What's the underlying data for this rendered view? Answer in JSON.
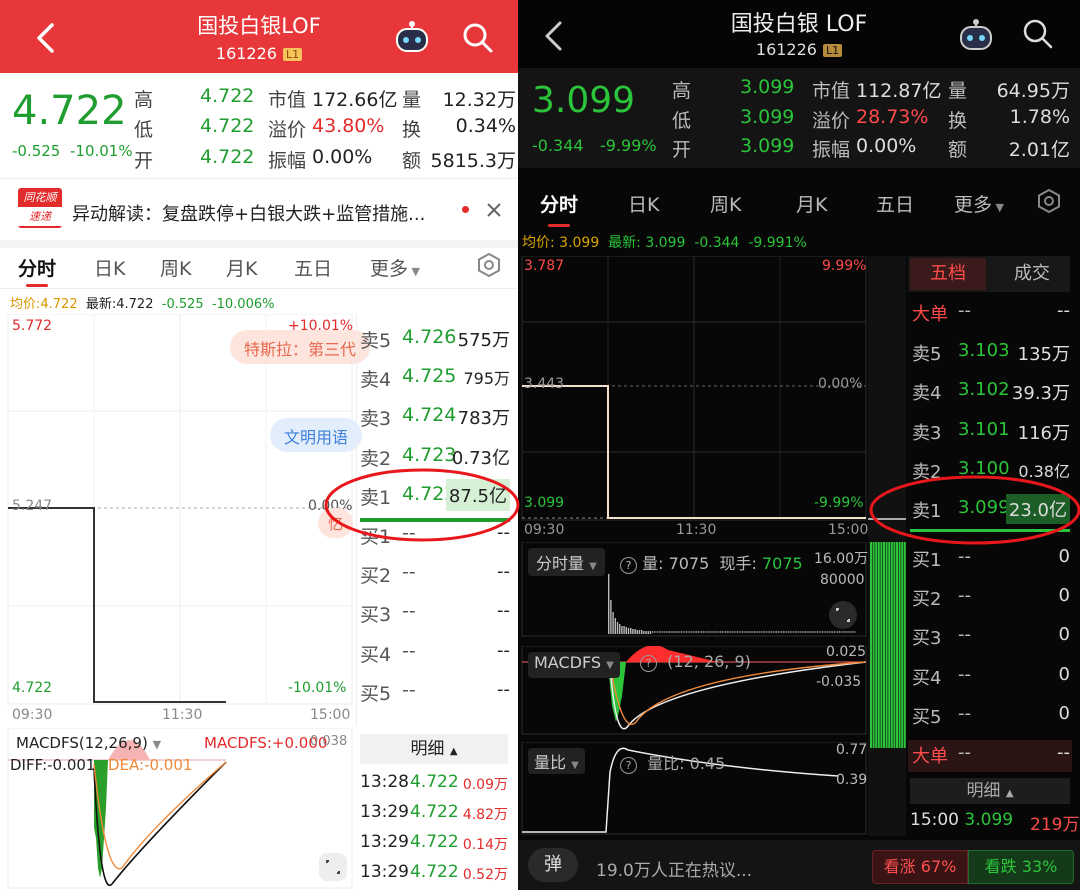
{
  "left": {
    "header": {
      "title": "国投白银LOF",
      "code": "161226",
      "level": "L1"
    },
    "quote": {
      "price": "4.722",
      "change": "-0.525",
      "change_pct": "-10.01%",
      "items": [
        {
          "label": "高",
          "value": "4.722"
        },
        {
          "label": "低",
          "value": "4.722"
        },
        {
          "label": "开",
          "value": "4.722"
        }
      ],
      "mid": [
        {
          "label": "市值",
          "value": "172.66亿"
        },
        {
          "label": "溢价",
          "value": "43.80%"
        },
        {
          "label": "振幅",
          "value": "0.00%"
        }
      ],
      "right": [
        {
          "label": "量",
          "value": "12.32万"
        },
        {
          "label": "换",
          "value": "0.34%"
        },
        {
          "label": "额",
          "value": "5815.3万"
        }
      ]
    },
    "news": {
      "logo_top": "同花顺",
      "logo_bottom": "速递",
      "text": "异动解读：复盘跌停+白银大跌+监管措施..."
    },
    "tabs": [
      "分时",
      "日K",
      "周K",
      "月K",
      "五日",
      "更多"
    ],
    "avg_line": {
      "avg_label": "均价:4.722",
      "latest_label": "最新:4.722",
      "change": "-0.525",
      "pct": "-10.006%"
    },
    "chart": {
      "y_top": "5.772",
      "y_mid": "5.247",
      "y_bottom": "4.722",
      "pct_top": "+10.01%",
      "pct_mid": "0.00%",
      "pct_bottom": "-10.01%",
      "t_start": "09:30",
      "t_mid": "11:30",
      "t_end": "15:00",
      "bubble1": "特斯拉：第三代",
      "bubble2": "文明用语",
      "bubble3": "忆"
    },
    "book": {
      "asks": [
        {
          "label": "卖5",
          "price": "4.726",
          "vol": "575万"
        },
        {
          "label": "卖4",
          "price": "4.725",
          "vol": "795万"
        },
        {
          "label": "卖3",
          "price": "4.724",
          "vol": "783万"
        },
        {
          "label": "卖2",
          "price": "4.723",
          "vol": "0.73亿"
        },
        {
          "label": "卖1",
          "price": "4.722",
          "vol": "87.5亿"
        }
      ],
      "bids": [
        {
          "label": "买1",
          "price": "--",
          "vol": "--"
        },
        {
          "label": "买2",
          "price": "--",
          "vol": "--"
        },
        {
          "label": "买3",
          "price": "--",
          "vol": "--"
        },
        {
          "label": "买4",
          "price": "--",
          "vol": "--"
        },
        {
          "label": "买5",
          "price": "--",
          "vol": "--"
        }
      ]
    },
    "detail": {
      "title": "明细",
      "rows": [
        {
          "time": "13:28",
          "price": "4.722",
          "vol": "0.09万"
        },
        {
          "time": "13:29",
          "price": "4.722",
          "vol": "4.82万"
        },
        {
          "time": "13:29",
          "price": "4.722",
          "vol": "0.14万"
        },
        {
          "time": "13:29",
          "price": "4.722",
          "vol": "0.52万"
        }
      ]
    },
    "macd": {
      "label": "MACDFS(12,26,9)",
      "value": "MACDFS:+0.000",
      "diff": "DIFF:-0.001",
      "dea": "DEA:-0.001",
      "axis": "0.038"
    }
  },
  "right": {
    "header": {
      "title": "国投白银 LOF",
      "code": "161226",
      "level": "L1"
    },
    "quote": {
      "price": "3.099",
      "change": "-0.344",
      "change_pct": "-9.99%",
      "items": [
        {
          "label": "高",
          "value": "3.099"
        },
        {
          "label": "低",
          "value": "3.099"
        },
        {
          "label": "开",
          "value": "3.099"
        }
      ],
      "mid": [
        {
          "label": "市值",
          "value": "112.87亿"
        },
        {
          "label": "溢价",
          "value": "28.73%"
        },
        {
          "label": "振幅",
          "value": "0.00%"
        }
      ],
      "right": [
        {
          "label": "量",
          "value": "64.95万"
        },
        {
          "label": "换",
          "value": "1.78%"
        },
        {
          "label": "额",
          "value": "2.01亿"
        }
      ]
    },
    "tabs": [
      "分时",
      "日K",
      "周K",
      "月K",
      "五日",
      "更多"
    ],
    "avg_line": {
      "avg_label": "均价: 3.099",
      "latest_label": "最新: 3.099",
      "change": "-0.344",
      "pct": "-9.991%"
    },
    "chart": {
      "y_top": "3.787",
      "y_mid": "3.443",
      "y_bottom": "3.099",
      "pct_top": "9.99%",
      "pct_mid": "0.00%",
      "pct_bottom": "-9.99%",
      "t_start": "09:30",
      "t_mid": "11:30",
      "t_end": "15:00"
    },
    "volume": {
      "label": "分时量",
      "vol": "量: 7075",
      "hand_label": "现手:",
      "hand": "7075",
      "axis_top": "16.00万",
      "axis_mid": "80000"
    },
    "macd": {
      "label": "MACDFS",
      "params": "(12, 26, 9)",
      "axis_top": "0.025",
      "axis_bottom": "-0.035"
    },
    "ratio": {
      "label": "量比",
      "value": "量比: 0.45",
      "axis_top": "0.77",
      "axis_bottom": "0.39"
    },
    "book": {
      "tab_active": "五档",
      "tab_other": "成交",
      "big_sell": {
        "label": "大单",
        "price": "--",
        "vol": "--"
      },
      "asks": [
        {
          "label": "卖5",
          "price": "3.103",
          "vol": "135万"
        },
        {
          "label": "卖4",
          "price": "3.102",
          "vol": "39.3万"
        },
        {
          "label": "卖3",
          "price": "3.101",
          "vol": "116万"
        },
        {
          "label": "卖2",
          "price": "3.100",
          "vol": "0.38亿"
        },
        {
          "label": "卖1",
          "price": "3.099",
          "vol": "23.0亿"
        }
      ],
      "bids": [
        {
          "label": "买1",
          "price": "--",
          "vol": "0"
        },
        {
          "label": "买2",
          "price": "--",
          "vol": "0"
        },
        {
          "label": "买3",
          "price": "--",
          "vol": "0"
        },
        {
          "label": "买4",
          "price": "--",
          "vol": "0"
        },
        {
          "label": "买5",
          "price": "--",
          "vol": "0"
        }
      ],
      "big_buy": {
        "label": "大单",
        "price": "--",
        "vol": "--"
      }
    },
    "detail": {
      "title": "明细",
      "rows": [
        {
          "time": "15:00",
          "price": "3.099",
          "vol": "219万"
        }
      ]
    },
    "footer": {
      "danmu": "弹",
      "discuss": "19.0万人正在热议...",
      "up": "看涨 67%",
      "down": "看跌 33%"
    }
  }
}
